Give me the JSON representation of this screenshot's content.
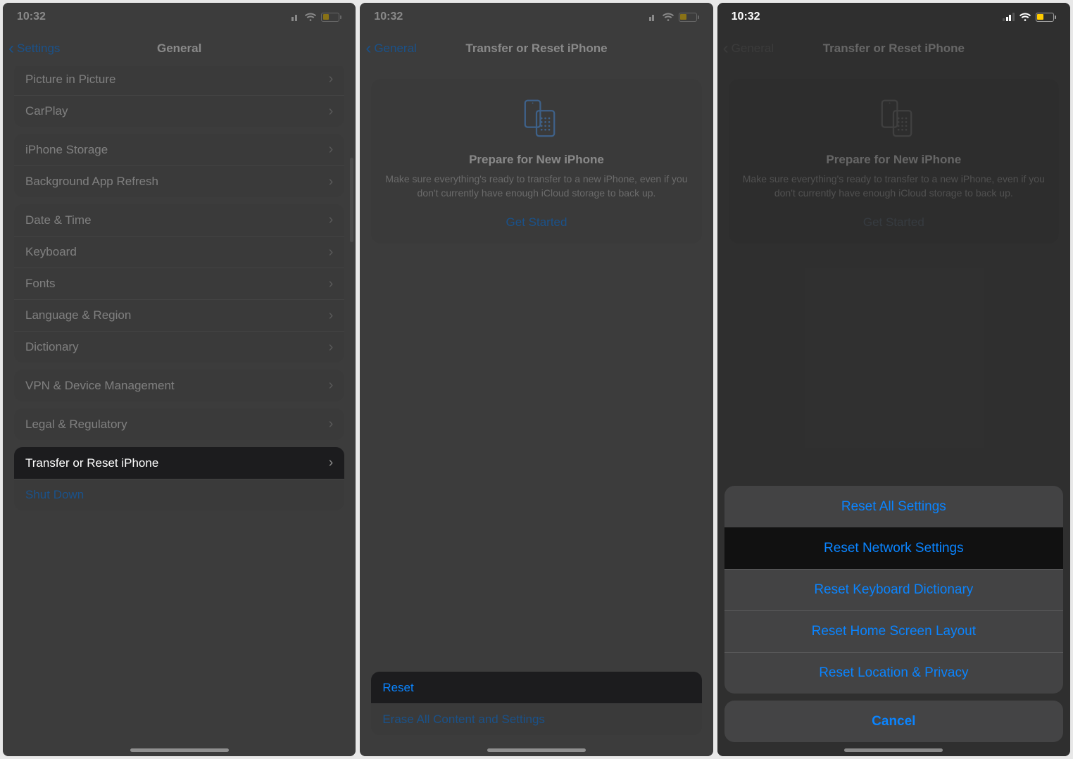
{
  "status": {
    "time": "10:32"
  },
  "screen1": {
    "back": "Settings",
    "title": "General",
    "group1": [
      "Picture in Picture",
      "CarPlay"
    ],
    "group2": [
      "iPhone Storage",
      "Background App Refresh"
    ],
    "group3": [
      "Date & Time",
      "Keyboard",
      "Fonts",
      "Language & Region",
      "Dictionary"
    ],
    "group4": [
      "VPN & Device Management"
    ],
    "group5": [
      "Legal & Regulatory"
    ],
    "group6": [
      "Transfer or Reset iPhone",
      "Shut Down"
    ]
  },
  "screen2": {
    "back": "General",
    "title": "Transfer or Reset iPhone",
    "card": {
      "title": "Prepare for New iPhone",
      "desc": "Make sure everything's ready to transfer to a new iPhone, even if you don't currently have enough iCloud storage to back up.",
      "cta": "Get Started"
    },
    "bottom": {
      "reset": "Reset",
      "erase": "Erase All Content and Settings"
    }
  },
  "screen3": {
    "back": "General",
    "title": "Transfer or Reset iPhone",
    "card": {
      "title": "Prepare for New iPhone",
      "desc": "Make sure everything's ready to transfer to a new iPhone, even if you don't currently have enough iCloud storage to back up.",
      "cta": "Get Started"
    },
    "sheet": {
      "options": [
        "Reset All Settings",
        "Reset Network Settings",
        "Reset Keyboard Dictionary",
        "Reset Home Screen Layout",
        "Reset Location & Privacy"
      ],
      "cancel": "Cancel"
    }
  }
}
